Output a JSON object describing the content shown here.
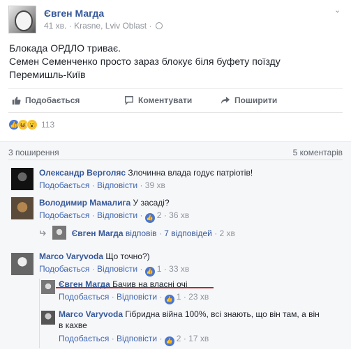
{
  "post": {
    "author": "Євген Магда",
    "time": "41 хв.",
    "location": "Krasne, Lviv Oblast",
    "text_lines": [
      "Блокада ОРДЛО триває.",
      "Семен Семенченко просто зараз блокує біля буфету поїзду",
      "Перемишль-Київ"
    ]
  },
  "actions": {
    "like": "Подобається",
    "comment": "Коментувати",
    "share": "Поширити"
  },
  "reactions": {
    "count": "113",
    "icons": [
      "like-icon",
      "haha-icon",
      "wow-icon"
    ]
  },
  "stats": {
    "shares": "3 поширення",
    "comments": "5 коментарів"
  },
  "colors": {
    "link": "#365899",
    "meta": "#90949c",
    "like_blue": "#4a76ce",
    "underline_red": "#c0232b"
  },
  "comments": [
    {
      "name": "Олександр Верголяс",
      "text": "Злочинна влада годує патріотів!",
      "like": "Подобається",
      "reply": "Відповісти",
      "time": "39 хв"
    },
    {
      "name": "Володимир Мамалига",
      "text": "У засаді?",
      "like": "Подобається",
      "reply": "Відповісти",
      "likes": "2",
      "time": "36 хв",
      "replies_summary": {
        "name": "Євген Магда",
        "text": "відповів",
        "count": "7 відповідей",
        "time": "2 хв"
      }
    },
    {
      "name": "Marco Varyvoda",
      "text": "Що точно?)",
      "like": "Подобається",
      "reply": "Відповісти",
      "likes": "1",
      "time": "33 хв",
      "replies": [
        {
          "name": "Євген Магда",
          "text": "Бачив на власні очі",
          "like": "Подобається",
          "reply": "Відповісти",
          "likes": "1",
          "time": "23 хв"
        },
        {
          "name": "Marco Varyvoda",
          "text_line1": "Гібридна війна 100%, всі знають, що він там, а він",
          "text_line2": "в кахве",
          "like": "Подобається",
          "reply": "Відповісти",
          "likes": "2",
          "time": "17 хв"
        }
      ]
    }
  ]
}
